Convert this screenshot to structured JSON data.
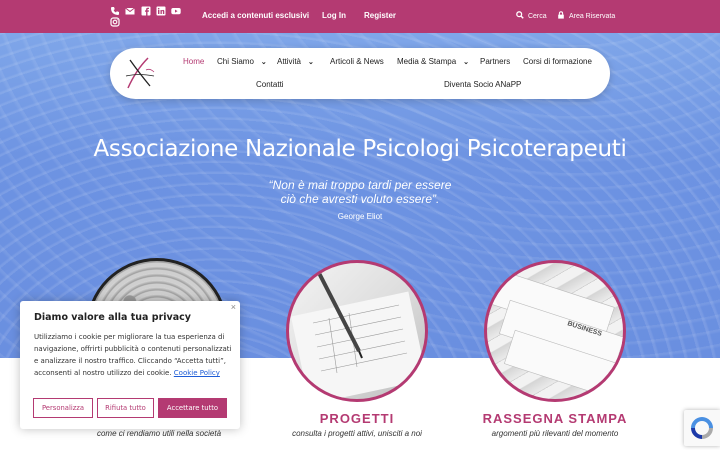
{
  "topbar": {
    "social_icons": [
      "phone-icon",
      "mail-icon",
      "facebook-icon",
      "linkedin-icon",
      "youtube-icon",
      "instagram-icon"
    ],
    "links": [
      "Accedi a contenuti esclusivi",
      "Log In",
      "Register"
    ],
    "search_label": "Cerca",
    "reserved_label": "Area Riservata"
  },
  "nav": {
    "items": [
      {
        "label": "Home"
      },
      {
        "label": "Chi Siamo"
      },
      {
        "label": "Attività"
      },
      {
        "label": "Articoli & News"
      },
      {
        "label": "Media & Stampa"
      },
      {
        "label": "Partners"
      },
      {
        "label": "Corsi di formazione"
      },
      {
        "label": "Contatti"
      },
      {
        "label": "Diventa Socio ANaPP"
      }
    ]
  },
  "hero": {
    "title": "Associazione Nazionale Psicologi Psicoterapeuti",
    "quote_line1": "“Non è mai troppo tardi per essere",
    "quote_line2": "ciò che avresti voluto essere”.",
    "author": "George Eliot"
  },
  "sections": [
    {
      "title": "",
      "subtitle": "come ci rendiamo utili nella società"
    },
    {
      "title": "PROGETTI",
      "subtitle": "consulta i progetti attivi, unisciti a noi"
    },
    {
      "title": "RASSEGNA STAMPA",
      "subtitle": "argomenti più rilevanti del momento"
    }
  ],
  "cookie": {
    "title": "Diamo valore alla tua privacy",
    "text": "Utilizziamo i cookie per migliorare la tua esperienza di navigazione, offrirti pubblicità o contenuti personalizzati e analizzare il nostro traffico. Cliccando “Accetta tutti”, acconsenti al nostro utilizzo dei cookie.",
    "policy_link": "Cookie Policy",
    "close": "×",
    "buttons": {
      "customize": "Personalizza",
      "reject": "Rifiuta tutto",
      "accept": "Accettare tutto"
    }
  },
  "colors": {
    "brand": "#b43a72",
    "hero": "#6d93e2"
  }
}
